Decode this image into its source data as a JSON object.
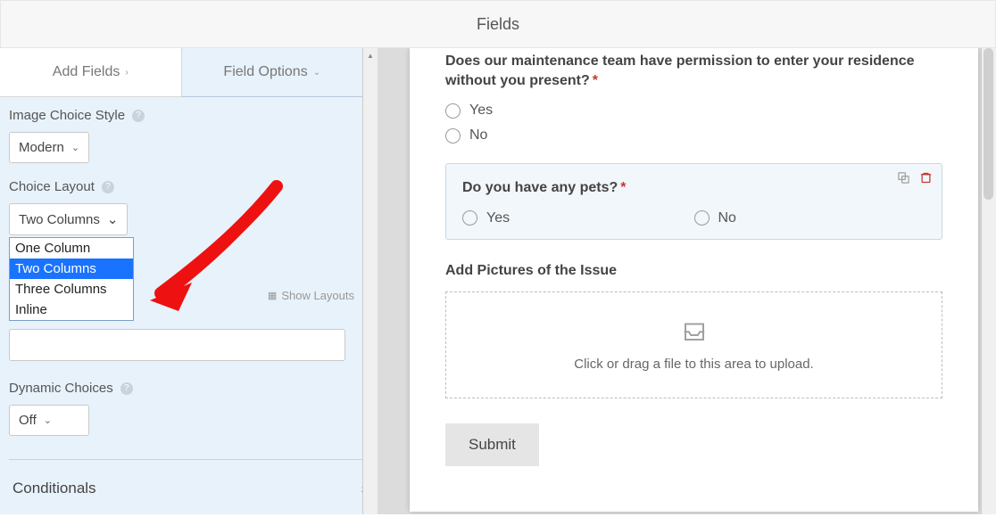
{
  "header": {
    "title": "Fields"
  },
  "tabs": {
    "add": "Add Fields",
    "options": "Field Options"
  },
  "sidebar": {
    "image_choice_style": {
      "label": "Image Choice Style",
      "value": "Modern"
    },
    "choice_layout": {
      "label": "Choice Layout",
      "selected": "Two Columns",
      "options": [
        "One Column",
        "Two Columns",
        "Three Columns",
        "Inline"
      ],
      "show_layouts": "Show Layouts"
    },
    "dynamic_choices": {
      "label": "Dynamic Choices",
      "value": "Off"
    },
    "conditionals": {
      "label": "Conditionals"
    }
  },
  "form": {
    "q_permission": {
      "label": "Does our maintenance team have permission to enter your residence without you present?",
      "options": [
        "Yes",
        "No"
      ]
    },
    "q_pets": {
      "label": "Do you have any pets?",
      "options": [
        "Yes",
        "No"
      ]
    },
    "upload": {
      "label": "Add Pictures of the Issue",
      "hint": "Click or drag a file to this area to upload."
    },
    "submit": "Submit"
  }
}
